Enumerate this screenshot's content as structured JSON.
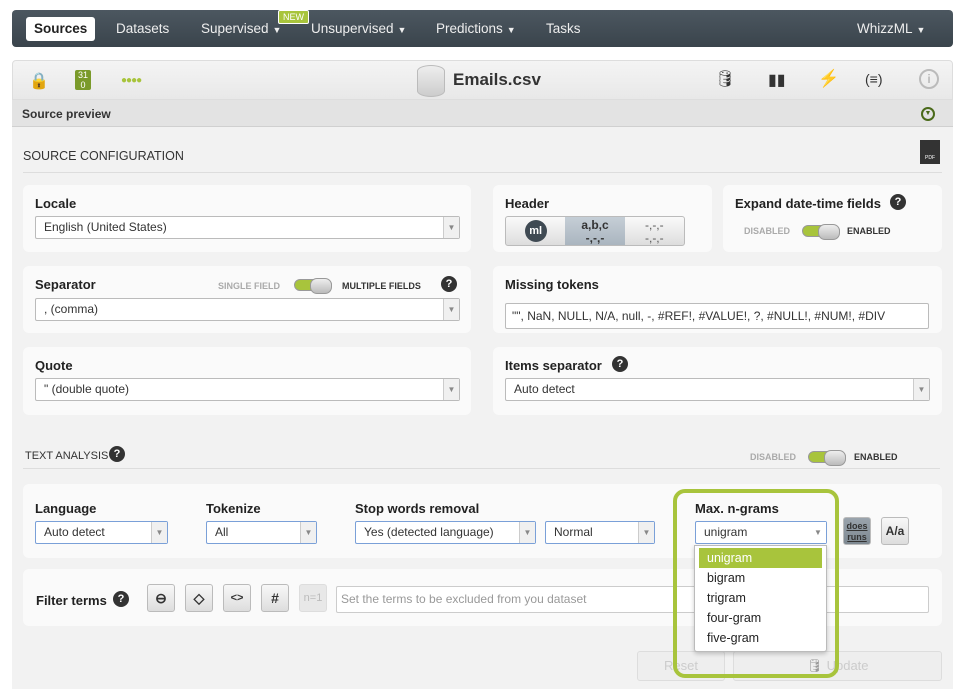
{
  "nav": {
    "items": [
      {
        "label": "Sources",
        "active": true
      },
      {
        "label": "Datasets"
      },
      {
        "label": "Supervised",
        "dropdown": true,
        "badge": "NEW"
      },
      {
        "label": "Unsupervised",
        "dropdown": true
      },
      {
        "label": "Predictions",
        "dropdown": true
      },
      {
        "label": "Tasks"
      }
    ],
    "right": "WhizzML"
  },
  "toolbar": {
    "title": "Emails.csv",
    "icons": [
      "lock-icon",
      "field-types-icon",
      "progress-dots-icon",
      "database-icon",
      "dataset-configure-icon",
      "chart-configure-icon",
      "one-click-icon",
      "formula-icon",
      "info-icon"
    ]
  },
  "preview": {
    "label": "Source preview"
  },
  "config": {
    "title": "SOURCE CONFIGURATION",
    "locale": {
      "label": "Locale",
      "value": "English (United States)"
    },
    "header": {
      "label": "Header",
      "options": [
        "ml",
        "a,b,c",
        "-,-,-"
      ],
      "sub": "-,-,-"
    },
    "expand": {
      "label": "Expand date-time fields",
      "off": "DISABLED",
      "on": "ENABLED",
      "enabled": true
    },
    "separator": {
      "label": "Separator",
      "off": "SINGLE FIELD",
      "on": "MULTIPLE FIELDS",
      "value": ", (comma)"
    },
    "missing": {
      "label": "Missing tokens",
      "value": "\"\", NaN, NULL, N/A, null, -, #REF!, #VALUE!, ?, #NULL!, #NUM!, #DIV"
    },
    "quote": {
      "label": "Quote",
      "value": "\" (double quote)"
    },
    "items_sep": {
      "label": "Items separator",
      "value": "Auto detect"
    }
  },
  "text": {
    "title": "TEXT ANALYSIS",
    "off": "DISABLED",
    "on": "ENABLED",
    "language": {
      "label": "Language",
      "value": "Auto detect"
    },
    "tokenize": {
      "label": "Tokenize",
      "value": "All"
    },
    "stop": {
      "label": "Stop words removal",
      "value": "Yes (detected language)",
      "level": "Normal"
    },
    "ngrams": {
      "label": "Max. n-grams",
      "value": "unigram",
      "options": [
        "unigram",
        "bigram",
        "trigram",
        "four-gram",
        "five-gram"
      ]
    },
    "stem_a": "does",
    "stem_b": "runs",
    "case": "A/a",
    "filter": {
      "label": "Filter terms",
      "n1": "n=1",
      "placeholder": "Set the terms to be excluded from you dataset"
    }
  },
  "actions": {
    "reset": "Reset",
    "update": "Update"
  },
  "colors": {
    "accent": "#a8c43c",
    "nav": "#3f4a53"
  }
}
